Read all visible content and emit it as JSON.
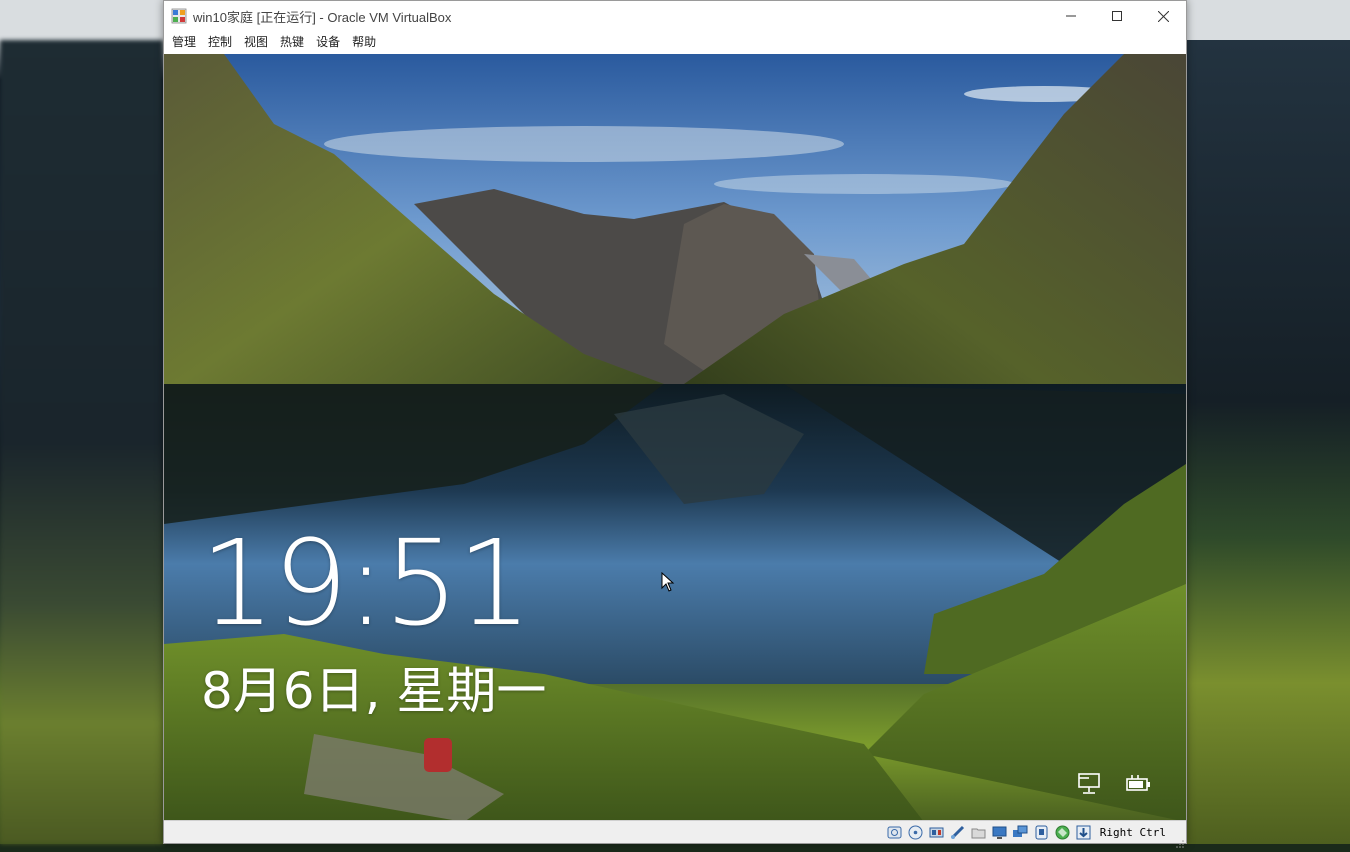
{
  "window": {
    "title": "win10家庭 [正在运行] - Oracle VM VirtualBox"
  },
  "menu": [
    "管理",
    "控制",
    "视图",
    "热键",
    "设备",
    "帮助"
  ],
  "lock_screen": {
    "time": "19:51",
    "date": "8月6日, 星期一"
  },
  "statusbar": {
    "icons": [
      "hard-disk-icon",
      "optical-disk-icon",
      "audio-icon",
      "usb-icon",
      "shared-folder-icon",
      "display-icon",
      "network-icon",
      "recording-icon",
      "cpu-icon",
      "guest-additions-icon",
      "mouse-integration-icon"
    ],
    "host_key": "Right Ctrl"
  },
  "colors": {
    "titlebar": "#ffffff",
    "statusbar": "#efefef",
    "clock_text": "#ffffff"
  }
}
